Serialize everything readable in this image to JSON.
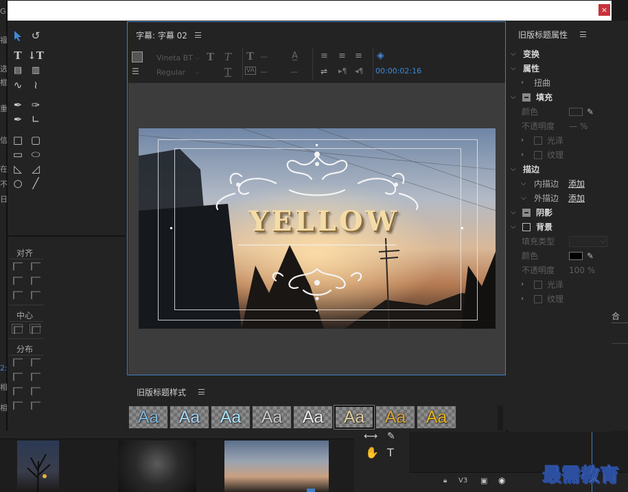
{
  "background": {
    "left_marks": [
      "G",
      "福",
      "选",
      "框",
      "重",
      "信",
      "在",
      "不",
      "日",
      "2:",
      "相",
      "相"
    ],
    "right_top": "合",
    "track_label": "V3",
    "bottom_tools": [
      "⟷",
      "✎",
      "✋",
      "T"
    ]
  },
  "dialog": {
    "close": "×"
  },
  "tools_panel": {
    "align_label": "对齐",
    "center_label": "中心",
    "distribute_label": "分布"
  },
  "main_panel": {
    "title": "字幕: 字幕 02",
    "font_family": "Vineta BT",
    "font_style": "Regular",
    "dash1": "—",
    "dash2": "—",
    "dash3": "—",
    "dash4": "—",
    "timecode": "00:00:02:16",
    "canvas_text": "YELLOW"
  },
  "styles_panel": {
    "title": "旧版标题样式",
    "swatch_label": "Aa",
    "swatches": [
      {
        "color": "#7fb3d8"
      },
      {
        "color": "#a6d2f0"
      },
      {
        "color": "#a9e1f5"
      },
      {
        "color": "#c7c7c7"
      },
      {
        "color": "#e8e8e8"
      },
      {
        "color": "#e0cfa0"
      },
      {
        "color": "#d8a43c"
      },
      {
        "color": "#e8b21c"
      }
    ]
  },
  "properties_panel": {
    "title": "旧版标题属性",
    "transform": "变换",
    "attributes": "属性",
    "distort": "扭曲",
    "fill": "填充",
    "color": "颜色",
    "opacity": "不透明度",
    "opacity_value": "— %",
    "sheen": "光泽",
    "texture": "纹理",
    "stroke": "描边",
    "inner_stroke": "内描边",
    "outer_stroke": "外描边",
    "add": "添加",
    "shadow": "阴影",
    "background": "背景",
    "fill_type": "填充类型",
    "bg_color": "颜色",
    "bg_opacity": "不透明度",
    "bg_opacity_value": "100 %",
    "bg_sheen": "光泽",
    "bg_texture": "纹理"
  },
  "watermark": "最需教育",
  "colors": {
    "accent_blue": "#3f80c8",
    "close_red": "#c8323a",
    "timecode_blue": "#3f8ad8"
  }
}
